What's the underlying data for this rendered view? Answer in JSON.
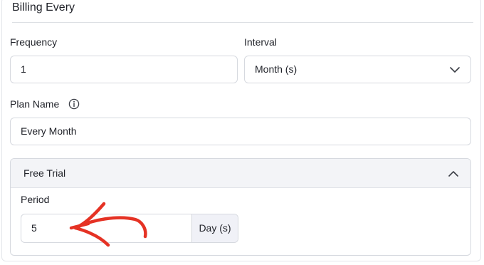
{
  "billing": {
    "section_title": "Billing Every",
    "frequency_label": "Frequency",
    "frequency_value": "1",
    "interval_label": "Interval",
    "interval_value": "Month (s)",
    "plan_name_label": "Plan Name",
    "plan_name_value": "Every Month"
  },
  "free_trial": {
    "title": "Free Trial",
    "expanded": true,
    "period_label": "Period",
    "period_value": "5",
    "period_unit": "Day (s)"
  },
  "icons": {
    "info": "info-icon",
    "interval_dropdown": "chevron-down-icon",
    "trial_toggle": "chevron-up-icon",
    "annotation": "red-arrow-icon"
  },
  "colors": {
    "annotation": "#e53224",
    "border": "#d6d9df",
    "header_bg": "#f3f4f7",
    "unit_bg": "#f0f1f7"
  }
}
